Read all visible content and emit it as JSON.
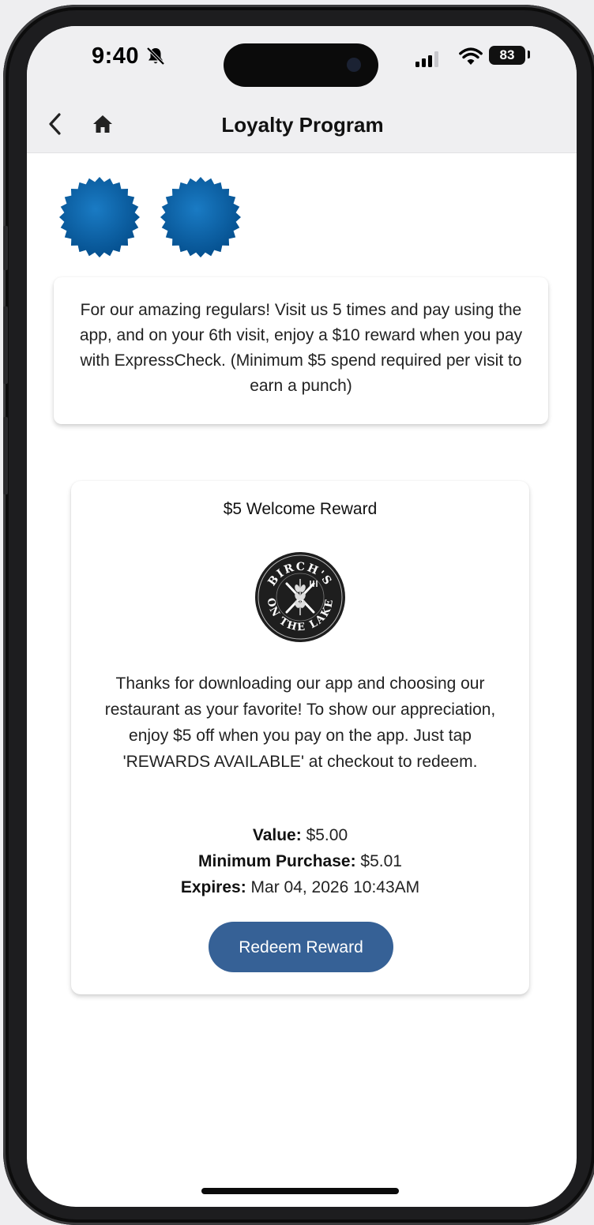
{
  "status": {
    "time": "9:40",
    "battery": "83",
    "icons": [
      "bell-slash-icon",
      "signal-icon",
      "wifi-icon",
      "battery-icon"
    ]
  },
  "navbar": {
    "title": "Loyalty Program",
    "icons": [
      "back-chevron-icon",
      "home-icon"
    ]
  },
  "punch_card": {
    "punches_earned": 2,
    "punch_color": "#0a5fa4",
    "description": "For our amazing regulars! Visit us 5 times and pay using the app, and on your 6th visit, enjoy a $10 reward when you pay with ExpressCheck. (Minimum $5 spend required per visit to earn a punch)"
  },
  "reward": {
    "title": "$5 Welcome Reward",
    "logo_text": "BIRCH'S ON THE LAKE",
    "description": "Thanks for downloading our app and choosing our restaurant as your favorite! To show our appreciation, enjoy $5 off when you pay on the app. Just tap 'REWARDS AVAILABLE' at checkout to redeem.",
    "value_label": "Value:",
    "value": "$5.00",
    "min_purchase_label": "Minimum Purchase:",
    "min_purchase": "$5.01",
    "expires_label": "Expires:",
    "expires": "Mar 04, 2026 10:43AM",
    "button_label": "Redeem Reward",
    "button_color": "#366196"
  }
}
